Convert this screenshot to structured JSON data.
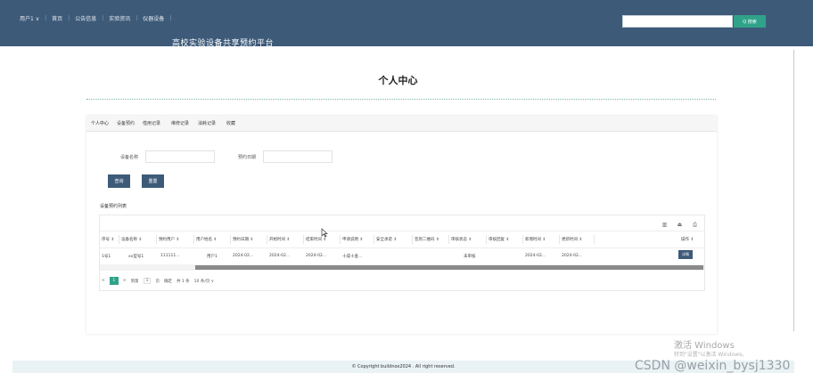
{
  "header": {
    "nav": [
      "用户1 ∨",
      "首页",
      "公告信息",
      "实验资讯",
      "仪器设备"
    ],
    "site_title": "高校实验设备共享预约平台",
    "search_placeholder": "",
    "search_button": "Q 搜索"
  },
  "page": {
    "heading": "个人中心"
  },
  "tabs": [
    "个人中心",
    "设备预约",
    "借用记录",
    "维修记录",
    "消耗记录",
    "收藏"
  ],
  "filters": {
    "device_name_label": "设备名称",
    "booking_date_label": "预约日期",
    "query_button": "查询",
    "reset_button": "重置"
  },
  "list": {
    "title": "设备预约列表",
    "columns": [
      "序号 ⇕",
      "设备名称 ⇕",
      "预约用户 ⇕",
      "用户姓名 ⇕",
      "预约日期 ⇕",
      "开始时间 ⇕",
      "结束时间 ⇕",
      "申请说明 ⇕",
      "安全承诺 ⇕",
      "签到二维码 ⇕",
      "审核状态 ⇕",
      "审核回复 ⇕",
      "新增时间 ⇕",
      "更新时间 ⇕",
      "操作 ⇕"
    ],
    "rows": [
      [
        "1号1",
        "xx型号1",
        "111111...",
        "用户1",
        "2024-02...",
        "2024-02...",
        "2024-02...",
        "十成十查...",
        "",
        "",
        "未审核",
        "",
        "2024-02...",
        "2024-02...",
        "详情"
      ]
    ]
  },
  "pager": {
    "prev": "<",
    "current": "1",
    "next": ">",
    "goto_label": "到第",
    "page_input": "1",
    "page_unit": "页",
    "confirm": "确定",
    "total": "共 1 条",
    "page_size": "10 条/页 ∨"
  },
  "footer": {
    "copyright": "© Copyright buildnox2024 . All right reserved."
  },
  "overlay": {
    "activate_title": "激活 Windows",
    "activate_sub": "转到\"设置\"以激活 Windows。",
    "csdn": "CSDN @weixin_bysj1330"
  }
}
